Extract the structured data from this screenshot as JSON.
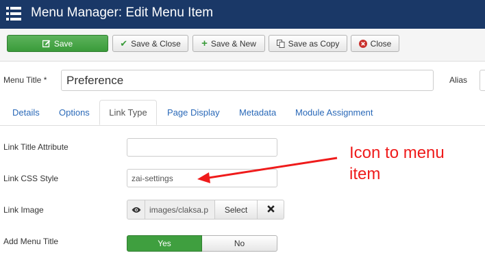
{
  "header": {
    "title": "Menu Manager: Edit Menu Item",
    "icon": "menu-list-icon"
  },
  "toolbar": {
    "save": "Save",
    "save_close": "Save & Close",
    "save_new": "Save & New",
    "save_copy": "Save as Copy",
    "close": "Close",
    "colors": {
      "save_bg": "#3f9f3f",
      "close_icon": "#c9302c"
    }
  },
  "form": {
    "menu_title_label": "Menu Title *",
    "menu_title_value": "Preference",
    "alias_label": "Alias"
  },
  "tabs": [
    "Details",
    "Options",
    "Link Type",
    "Page Display",
    "Metadata",
    "Module Assignment"
  ],
  "active_tab": "Link Type",
  "fields": {
    "link_title_attr_label": "Link Title Attribute",
    "link_title_attr_value": "",
    "link_css_style_label": "Link CSS Style",
    "link_css_style_value": "zai-settings",
    "link_image_label": "Link Image",
    "link_image_value": "images/claksa.p",
    "link_image_select": "Select",
    "add_menu_title_label": "Add Menu Title",
    "yes_label": "Yes",
    "no_label": "No",
    "add_menu_title_selected": "Yes"
  },
  "annotation": {
    "line1": "Icon to menu",
    "line2": "item",
    "color": "#ef1b1b"
  }
}
